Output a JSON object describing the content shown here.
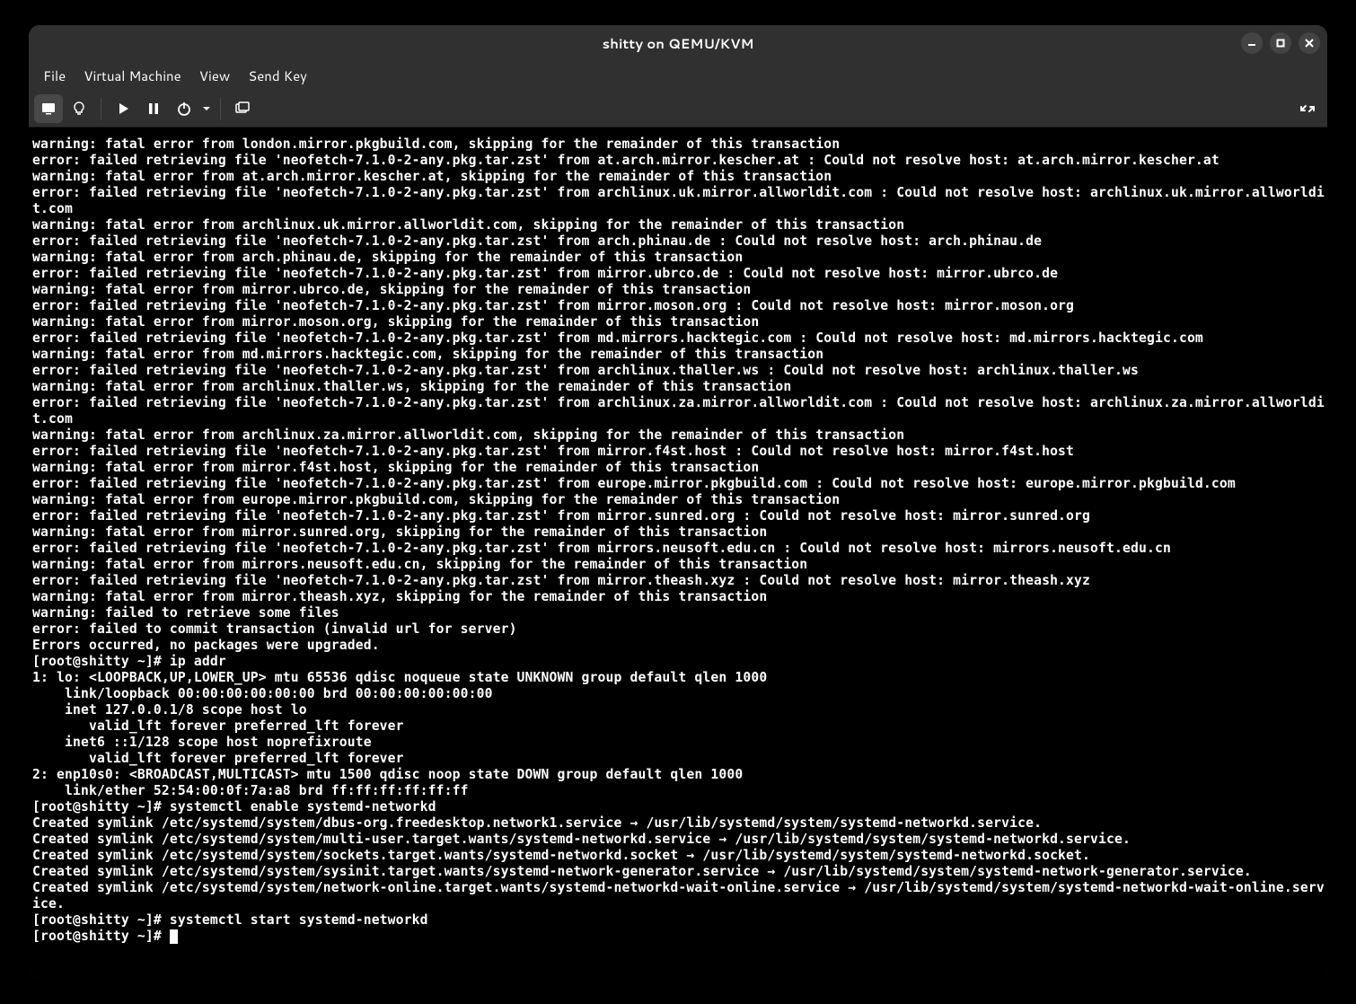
{
  "titlebar": {
    "title": "shitty on QEMU/KVM"
  },
  "menubar": {
    "items": [
      {
        "label": "File"
      },
      {
        "label": "Virtual Machine"
      },
      {
        "label": "View"
      },
      {
        "label": "Send Key"
      }
    ]
  },
  "toolbar": {
    "console_icon": "console",
    "info_icon": "info",
    "play_icon": "play",
    "pause_icon": "pause",
    "power_icon": "power",
    "snapshot_icon": "snapshot",
    "fullscreen_icon": "fullscreen"
  },
  "console_lines": [
    "warning: fatal error from london.mirror.pkgbuild.com, skipping for the remainder of this transaction",
    "error: failed retrieving file 'neofetch-7.1.0-2-any.pkg.tar.zst' from at.arch.mirror.kescher.at : Could not resolve host: at.arch.mirror.kescher.at",
    "warning: fatal error from at.arch.mirror.kescher.at, skipping for the remainder of this transaction",
    "error: failed retrieving file 'neofetch-7.1.0-2-any.pkg.tar.zst' from archlinux.uk.mirror.allworldit.com : Could not resolve host: archlinux.uk.mirror.allworldi",
    "t.com",
    "warning: fatal error from archlinux.uk.mirror.allworldit.com, skipping for the remainder of this transaction",
    "error: failed retrieving file 'neofetch-7.1.0-2-any.pkg.tar.zst' from arch.phinau.de : Could not resolve host: arch.phinau.de",
    "warning: fatal error from arch.phinau.de, skipping for the remainder of this transaction",
    "error: failed retrieving file 'neofetch-7.1.0-2-any.pkg.tar.zst' from mirror.ubrco.de : Could not resolve host: mirror.ubrco.de",
    "warning: fatal error from mirror.ubrco.de, skipping for the remainder of this transaction",
    "error: failed retrieving file 'neofetch-7.1.0-2-any.pkg.tar.zst' from mirror.moson.org : Could not resolve host: mirror.moson.org",
    "warning: fatal error from mirror.moson.org, skipping for the remainder of this transaction",
    "error: failed retrieving file 'neofetch-7.1.0-2-any.pkg.tar.zst' from md.mirrors.hacktegic.com : Could not resolve host: md.mirrors.hacktegic.com",
    "warning: fatal error from md.mirrors.hacktegic.com, skipping for the remainder of this transaction",
    "error: failed retrieving file 'neofetch-7.1.0-2-any.pkg.tar.zst' from archlinux.thaller.ws : Could not resolve host: archlinux.thaller.ws",
    "warning: fatal error from archlinux.thaller.ws, skipping for the remainder of this transaction",
    "error: failed retrieving file 'neofetch-7.1.0-2-any.pkg.tar.zst' from archlinux.za.mirror.allworldit.com : Could not resolve host: archlinux.za.mirror.allworldi",
    "t.com",
    "warning: fatal error from archlinux.za.mirror.allworldit.com, skipping for the remainder of this transaction",
    "error: failed retrieving file 'neofetch-7.1.0-2-any.pkg.tar.zst' from mirror.f4st.host : Could not resolve host: mirror.f4st.host",
    "warning: fatal error from mirror.f4st.host, skipping for the remainder of this transaction",
    "error: failed retrieving file 'neofetch-7.1.0-2-any.pkg.tar.zst' from europe.mirror.pkgbuild.com : Could not resolve host: europe.mirror.pkgbuild.com",
    "warning: fatal error from europe.mirror.pkgbuild.com, skipping for the remainder of this transaction",
    "error: failed retrieving file 'neofetch-7.1.0-2-any.pkg.tar.zst' from mirror.sunred.org : Could not resolve host: mirror.sunred.org",
    "warning: fatal error from mirror.sunred.org, skipping for the remainder of this transaction",
    "error: failed retrieving file 'neofetch-7.1.0-2-any.pkg.tar.zst' from mirrors.neusoft.edu.cn : Could not resolve host: mirrors.neusoft.edu.cn",
    "warning: fatal error from mirrors.neusoft.edu.cn, skipping for the remainder of this transaction",
    "error: failed retrieving file 'neofetch-7.1.0-2-any.pkg.tar.zst' from mirror.theash.xyz : Could not resolve host: mirror.theash.xyz",
    "warning: fatal error from mirror.theash.xyz, skipping for the remainder of this transaction",
    "warning: failed to retrieve some files",
    "error: failed to commit transaction (invalid url for server)",
    "Errors occurred, no packages were upgraded.",
    "[root@shitty ~]# ip addr",
    "1: lo: <LOOPBACK,UP,LOWER_UP> mtu 65536 qdisc noqueue state UNKNOWN group default qlen 1000",
    "    link/loopback 00:00:00:00:00:00 brd 00:00:00:00:00:00",
    "    inet 127.0.0.1/8 scope host lo",
    "       valid_lft forever preferred_lft forever",
    "    inet6 ::1/128 scope host noprefixroute",
    "       valid_lft forever preferred_lft forever",
    "2: enp10s0: <BROADCAST,MULTICAST> mtu 1500 qdisc noop state DOWN group default qlen 1000",
    "    link/ether 52:54:00:0f:7a:a8 brd ff:ff:ff:ff:ff:ff",
    "[root@shitty ~]# systemctl enable systemd-networkd",
    "Created symlink /etc/systemd/system/dbus-org.freedesktop.network1.service → /usr/lib/systemd/system/systemd-networkd.service.",
    "Created symlink /etc/systemd/system/multi-user.target.wants/systemd-networkd.service → /usr/lib/systemd/system/systemd-networkd.service.",
    "Created symlink /etc/systemd/system/sockets.target.wants/systemd-networkd.socket → /usr/lib/systemd/system/systemd-networkd.socket.",
    "Created symlink /etc/systemd/system/sysinit.target.wants/systemd-network-generator.service → /usr/lib/systemd/system/systemd-network-generator.service.",
    "Created symlink /etc/systemd/system/network-online.target.wants/systemd-networkd-wait-online.service → /usr/lib/systemd/system/systemd-networkd-wait-online.serv",
    "ice.",
    "[root@shitty ~]# systemctl start systemd-networkd",
    "[root@shitty ~]# "
  ]
}
